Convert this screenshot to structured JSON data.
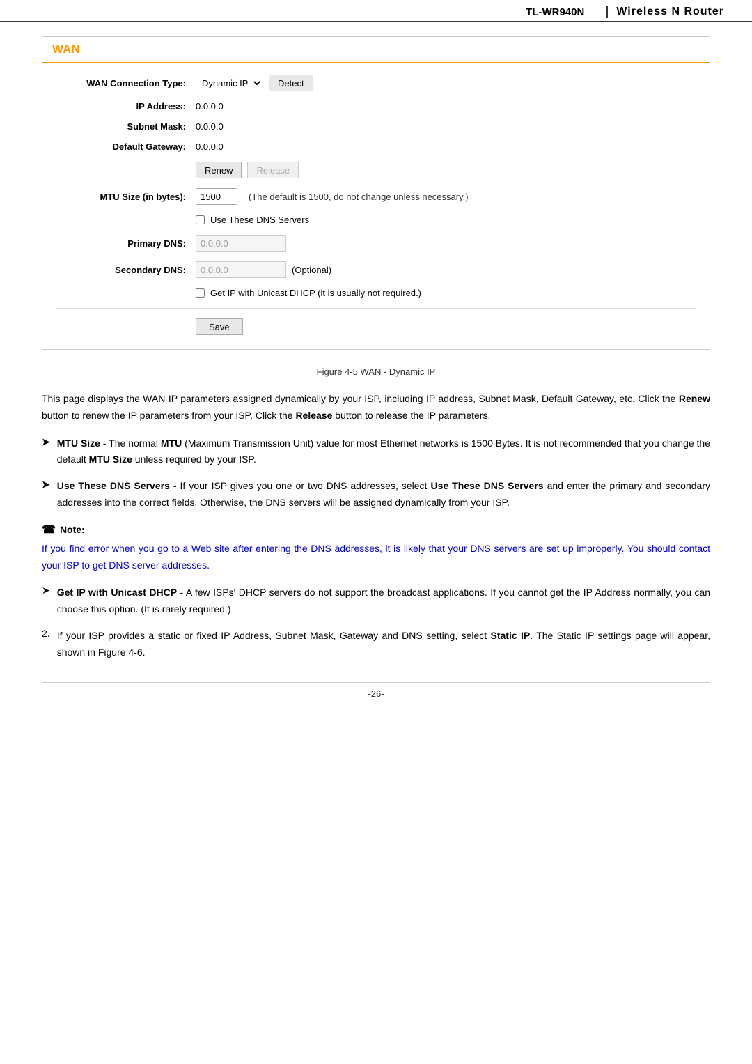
{
  "header": {
    "model": "TL-WR940N",
    "separator": "|",
    "title": "Wireless N Router"
  },
  "wan_panel": {
    "title": "WAN",
    "connection_type_label": "WAN Connection Type:",
    "connection_type_value": "Dynamic IP",
    "detect_button": "Detect",
    "ip_address_label": "IP Address:",
    "ip_address_value": "0.0.0.0",
    "subnet_mask_label": "Subnet Mask:",
    "subnet_mask_value": "0.0.0.0",
    "default_gateway_label": "Default Gateway:",
    "default_gateway_value": "0.0.0.0",
    "renew_button": "Renew",
    "release_button": "Release",
    "mtu_label": "MTU Size (in bytes):",
    "mtu_value": "1500",
    "mtu_note": "(The default is 1500, do not change unless necessary.)",
    "dns_checkbox_label": "Use These DNS Servers",
    "primary_dns_label": "Primary DNS:",
    "primary_dns_value": "0.0.0.0",
    "secondary_dns_label": "Secondary DNS:",
    "secondary_dns_value": "0.0.0.0",
    "secondary_dns_optional": "(Optional)",
    "unicast_label": "Get IP with Unicast DHCP (it is usually not required.)",
    "save_button": "Save"
  },
  "figure_caption": "Figure 4-5  WAN - Dynamic IP",
  "body_paragraph": "This page displays the WAN IP parameters assigned dynamically by your ISP, including IP address, Subnet Mask, Default Gateway, etc. Click the Renew button to renew the IP parameters from your ISP. Click the Release button to release the IP parameters.",
  "bullet_items": [
    {
      "arrow": "➤",
      "content_parts": [
        {
          "bold": true,
          "text": "MTU Size"
        },
        {
          "bold": false,
          "text": " - The normal "
        },
        {
          "bold": true,
          "text": "MTU"
        },
        {
          "bold": false,
          "text": " (Maximum Transmission Unit) value for most Ethernet networks is 1500 Bytes. It is not recommended that you change the default "
        },
        {
          "bold": true,
          "text": "MTU Size"
        },
        {
          "bold": false,
          "text": " unless required by your ISP."
        }
      ]
    },
    {
      "arrow": "➤",
      "content_parts": [
        {
          "bold": true,
          "text": "Use These DNS Servers"
        },
        {
          "bold": false,
          "text": " - If your ISP gives you one or two DNS addresses, select "
        },
        {
          "bold": true,
          "text": "Use These DNS Servers"
        },
        {
          "bold": false,
          "text": " and enter the primary and secondary addresses into the correct fields. Otherwise, the DNS servers will be assigned dynamically from your ISP."
        }
      ]
    }
  ],
  "note_label": "Note:",
  "note_icon": "☎",
  "note_text": "If you find error when you go to a Web site after entering the DNS addresses, it is likely that your DNS servers are set up improperly. You should contact your ISP to get DNS server addresses.",
  "numbered_items": [
    {
      "number": "➤",
      "content_parts": [
        {
          "bold": true,
          "text": "Get IP with Unicast DHCP"
        },
        {
          "bold": false,
          "text": " - A few ISPs' DHCP servers do not support the broadcast applications. If you cannot get the IP Address normally, you can choose this option. (It is rarely required.)"
        }
      ]
    },
    {
      "number": "2.",
      "content_parts": [
        {
          "bold": false,
          "text": "If your ISP provides a static or fixed IP Address, Subnet Mask, Gateway and DNS setting, select "
        },
        {
          "bold": true,
          "text": "Static IP"
        },
        {
          "bold": false,
          "text": ". The Static IP settings page will appear, shown in Figure 4-6."
        }
      ]
    }
  ],
  "page_number": "-26-"
}
